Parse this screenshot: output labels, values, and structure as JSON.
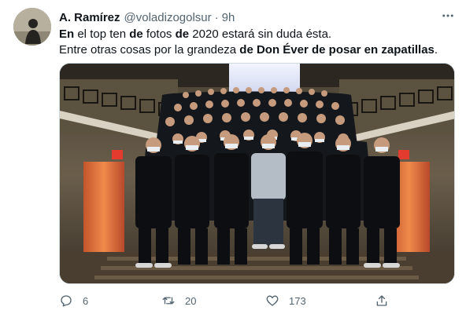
{
  "tweet": {
    "author": {
      "display_name": "A. Ramírez",
      "handle": "@voladizogolsur",
      "time": "9h"
    },
    "text": {
      "line1": [
        {
          "t": "En",
          "b": true
        },
        {
          "t": " el ",
          "b": false
        },
        {
          "t": "top ten",
          "b": false
        },
        {
          "t": " ",
          "b": false
        },
        {
          "t": "de",
          "b": true
        },
        {
          "t": " fotos ",
          "b": false
        },
        {
          "t": "de",
          "b": true
        },
        {
          "t": " 2020 estará sin duda ésta.",
          "b": false
        }
      ],
      "line2": [
        {
          "t": "Entre otras cosas por la grandeza ",
          "b": false
        },
        {
          "t": "de Don Éver de posar en zapatillas",
          "b": true
        },
        {
          "t": ".",
          "b": false
        }
      ]
    },
    "media": {
      "kind": "photo",
      "subject": "team-photo-on-staircase"
    },
    "actions": {
      "reply_count": "6",
      "retweet_count": "20",
      "like_count": "173"
    },
    "icons": {
      "avatar": "silhouette-avatar-icon",
      "more": "more-options-icon",
      "reply": "reply-icon",
      "retweet": "retweet-icon",
      "like": "heart-icon",
      "share": "share-icon"
    },
    "colors": {
      "text": "#0f1419",
      "muted": "#536471",
      "border": "#cfd9de"
    }
  }
}
